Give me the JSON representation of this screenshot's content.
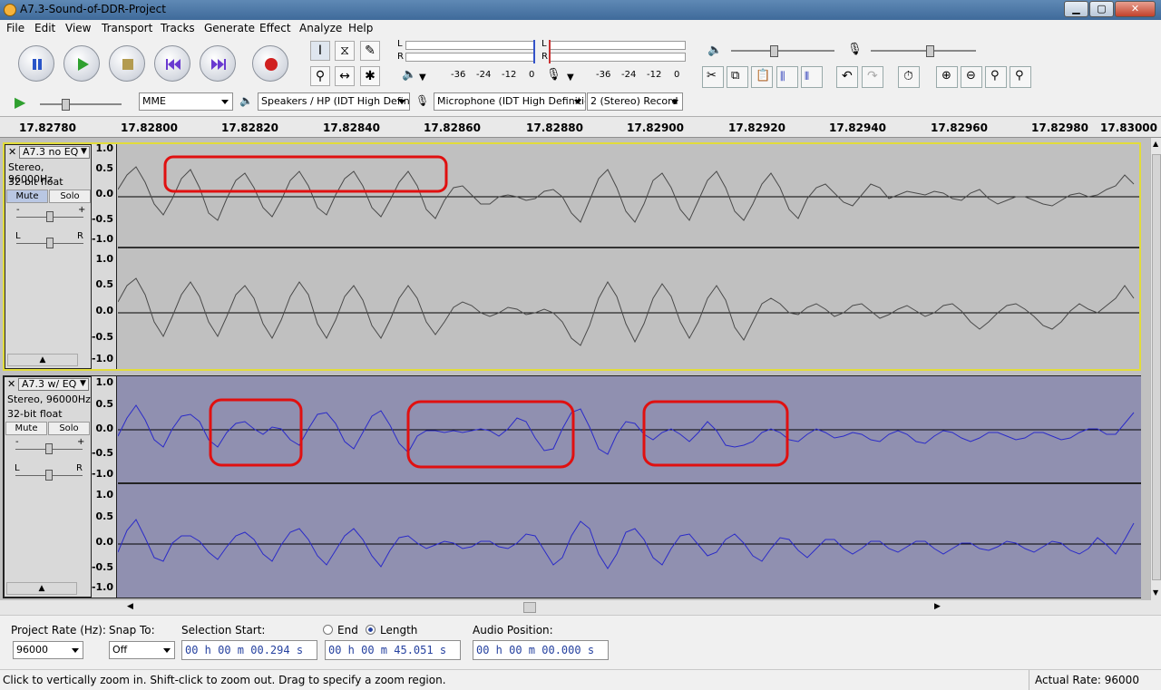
{
  "window": {
    "title": "A7.3-Sound-of-DDR-Project"
  },
  "menu": [
    "File",
    "Edit",
    "View",
    "Transport",
    "Tracks",
    "Generate",
    "Effect",
    "Analyze",
    "Help"
  ],
  "meters": {
    "lr": [
      "L",
      "R",
      "L",
      "R"
    ],
    "ticks_play": [
      "-36",
      "-24",
      "-12",
      "0"
    ],
    "ticks_rec": [
      "-36",
      "-24",
      "-12",
      "0"
    ]
  },
  "devices": {
    "host": "MME",
    "output": "Speakers / HP (IDT High Defini",
    "input": "Microphone (IDT High Definitio",
    "channels": "2 (Stereo) Record"
  },
  "ruler": [
    "17.82780",
    "17.82800",
    "17.82820",
    "17.82840",
    "17.82860",
    "17.82880",
    "17.82900",
    "17.82920",
    "17.82940",
    "17.82960",
    "17.82980",
    "17.83000"
  ],
  "tracks": [
    {
      "name": "A7.3 no EQ",
      "info1": "Stereo, 96000Hz",
      "info2": "32-bit float",
      "mute": "Mute",
      "solo": "Solo",
      "pan_l": "L",
      "pan_r": "R",
      "gain_minus": "-",
      "gain_plus": "+",
      "scale": [
        "1.0",
        "0.5",
        "0.0",
        "-0.5",
        "-1.0"
      ],
      "color": "#4a4a4a"
    },
    {
      "name": "A7.3 w/ EQ",
      "info1": "Stereo, 96000Hz",
      "info2": "32-bit float",
      "mute": "Mute",
      "solo": "Solo",
      "pan_l": "L",
      "pan_r": "R",
      "gain_minus": "-",
      "gain_plus": "+",
      "scale": [
        "1.0",
        "0.5",
        "0.0",
        "-0.5",
        "-1.0"
      ],
      "color": "#2b2bc8"
    }
  ],
  "selection": {
    "project_rate_label": "Project Rate (Hz):",
    "project_rate": "96000",
    "snap_label": "Snap To:",
    "snap": "Off",
    "start_label": "Selection Start:",
    "start": "00 h 00 m 00.294 s",
    "end_label": "End",
    "length_label": "Length",
    "length": "00 h 00 m 45.051 s",
    "position_label": "Audio Position:",
    "position": "00 h 00 m 00.000 s"
  },
  "status": {
    "hint": "Click to vertically zoom in. Shift-click to zoom out. Drag to specify a zoom region.",
    "rate": "Actual Rate: 96000"
  },
  "colors": {
    "selected_track_bg": "#c0c0c0",
    "track2_bg": "#9090b0",
    "annotation": "#e01010"
  }
}
